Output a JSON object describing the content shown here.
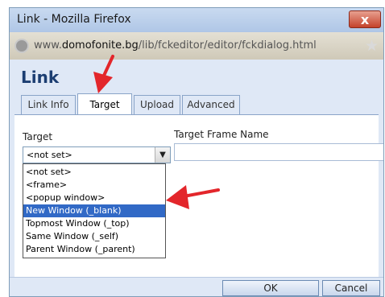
{
  "window": {
    "title": "Link - Mozilla Firefox",
    "close_glyph": "x"
  },
  "address_bar": {
    "url_prefix": "www.",
    "url_host": "domofonite.bg",
    "url_path": "/lib/fckeditor/editor/fckdialog.html"
  },
  "dialog": {
    "title": "Link",
    "tabs": [
      {
        "label": "Link Info",
        "active": false
      },
      {
        "label": "Target",
        "active": true
      },
      {
        "label": "Upload",
        "active": false
      },
      {
        "label": "Advanced",
        "active": false
      }
    ],
    "target_label": "Target",
    "target_selected": "<not set>",
    "dropdown_arrow": "▼",
    "frame_name_label": "Target Frame Name",
    "frame_name_value": "",
    "target_options": [
      "<not set>",
      "<frame>",
      "<popup window>",
      "New Window (_blank)",
      "Topmost Window (_top)",
      "Same Window (_self)",
      "Parent Window (_parent)"
    ],
    "highlighted_option": "New Window (_blank)",
    "ok_label": "OK",
    "cancel_label": "Cancel"
  },
  "colors": {
    "annotation_arrow": "#e3262b",
    "selection_highlight": "#3169c6",
    "dialog_title": "#1c3e72"
  }
}
